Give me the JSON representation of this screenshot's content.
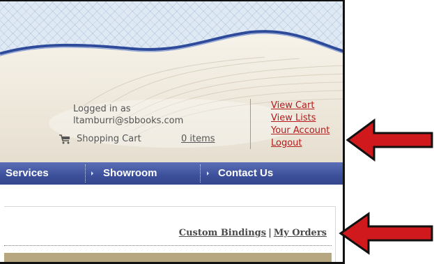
{
  "account": {
    "logged_in_label": "Logged in as",
    "email": "ltamburri@sbbooks.com",
    "cart_label": "Shopping Cart",
    "cart_items": "0 items",
    "cart_icon": "cart-icon"
  },
  "account_links": [
    {
      "label": "View Cart"
    },
    {
      "label": "View Lists"
    },
    {
      "label": "Your Account"
    },
    {
      "label": "Logout"
    }
  ],
  "nav": {
    "items": [
      {
        "label": "Services"
      },
      {
        "label": "Showroom"
      },
      {
        "label": "Contact Us"
      }
    ]
  },
  "orders": {
    "custom_bindings": "Custom Bindings",
    "separator": "|",
    "my_orders": "My Orders"
  },
  "colors": {
    "link_red": "#b31b1b",
    "nav_blue": "#3c4f9a",
    "arrow_red": "#d0191c",
    "tan_bar": "#b7a781"
  }
}
